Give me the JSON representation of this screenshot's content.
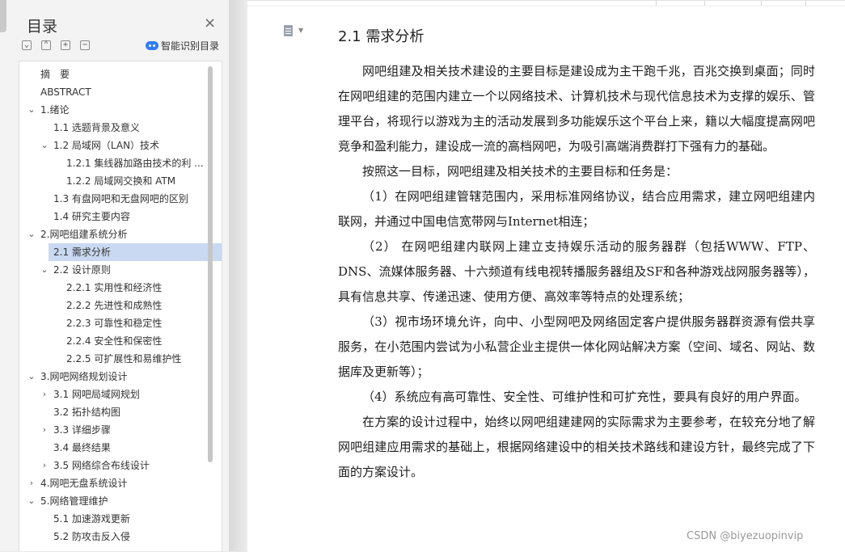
{
  "toc": {
    "title": "目录",
    "close_symbol": "×",
    "tools": [
      "⌄",
      "⌃",
      "+",
      "−"
    ],
    "smart_label": "智能识别目录",
    "items": [
      {
        "label": "摘　要",
        "level": 0,
        "arrow": "",
        "active": false
      },
      {
        "label": "ABSTRACT",
        "level": 0,
        "arrow": "",
        "active": false
      },
      {
        "label": "1.绪论",
        "level": 0,
        "arrow": "⌄",
        "active": false
      },
      {
        "label": "1.1 选题背景及意义",
        "level": 1,
        "arrow": "",
        "active": false
      },
      {
        "label": "1.2 局域网（LAN）技术",
        "level": 1,
        "arrow": "⌄",
        "active": false
      },
      {
        "label": "1.2.1 集线器加路由技术的利 ...",
        "level": 2,
        "arrow": "",
        "active": false
      },
      {
        "label": "1.2.2 局域网交换和 ATM",
        "level": 2,
        "arrow": "",
        "active": false
      },
      {
        "label": "1.3 有盘网吧和无盘网吧的区别",
        "level": 1,
        "arrow": "",
        "active": false
      },
      {
        "label": "1.4 研究主要内容",
        "level": 1,
        "arrow": "",
        "active": false
      },
      {
        "label": "2.网吧组建系统分析",
        "level": 0,
        "arrow": "⌄",
        "active": false
      },
      {
        "label": "2.1 需求分析",
        "level": 1,
        "arrow": "",
        "active": true
      },
      {
        "label": "2.2 设计原则",
        "level": 1,
        "arrow": "⌄",
        "active": false
      },
      {
        "label": "2.2.1 实用性和经济性",
        "level": 2,
        "arrow": "",
        "active": false
      },
      {
        "label": "2.2.2 先进性和成熟性",
        "level": 2,
        "arrow": "",
        "active": false
      },
      {
        "label": "2.2.3 可靠性和稳定性",
        "level": 2,
        "arrow": "",
        "active": false
      },
      {
        "label": "2.2.4 安全性和保密性",
        "level": 2,
        "arrow": "",
        "active": false
      },
      {
        "label": "2.2.5 可扩展性和易维护性",
        "level": 2,
        "arrow": "",
        "active": false
      },
      {
        "label": "3.网吧网络规划设计",
        "level": 0,
        "arrow": "⌄",
        "active": false
      },
      {
        "label": "3.1 网吧局域网规划",
        "level": 1,
        "arrow": "›",
        "active": false
      },
      {
        "label": "3.2 拓扑结构图",
        "level": 1,
        "arrow": "",
        "active": false
      },
      {
        "label": "3.3 详细步骤",
        "level": 1,
        "arrow": "›",
        "active": false
      },
      {
        "label": "3.4 最终结果",
        "level": 1,
        "arrow": "",
        "active": false
      },
      {
        "label": "3.5 网络综合布线设计",
        "level": 1,
        "arrow": "›",
        "active": false
      },
      {
        "label": "4.网吧无盘系统设计",
        "level": 0,
        "arrow": "›",
        "active": false
      },
      {
        "label": "5.网络管理维护",
        "level": 0,
        "arrow": "⌄",
        "active": false
      },
      {
        "label": "5.1 加速游戏更新",
        "level": 1,
        "arrow": "",
        "active": false
      },
      {
        "label": "5.2 防攻击反入侵",
        "level": 1,
        "arrow": "",
        "active": false
      }
    ]
  },
  "document": {
    "heading": "2.1 需求分析",
    "paragraphs": [
      "网吧组建及相关技术建设的主要目标是建设成为主干跑千兆，百兆交换到桌面；同时在网吧组建的范围内建立一个以网络技术、计算机技术与现代信息技术为支撑的娱乐、管理平台，将现行以游戏为主的活动发展到多功能娱乐这个平台上来，籍以大幅度提高网吧竞争和盈利能力，建设成一流的高档网吧，为吸引高端消费群打下强有力的基础。",
      "按照这一目标，网吧组建及相关技术的主要目标和任务是：",
      "（1）在网吧组建管辖范围内，采用标准网络协议，结合应用需求，建立网吧组建内联网，并通过中国电信宽带网与Internet相连；",
      "（2） 在网吧组建内联网上建立支持娱乐活动的服务器群（包括WWW、FTP、DNS、流媒体服务器、十六频道有线电视转播服务器组及SF和各种游戏战网服务器等），具有信息共享、传递迅速、使用方便、高效率等特点的处理系统；",
      "（3）视市场环境允许，向中、小型网吧及网络固定客户提供服务器群资源有偿共享服务，在小范围内尝试为小私营企业主提供一体化网站解决方案（空间、域名、网站、数据库及更新等）；",
      "（4）系统应有高可靠性、安全性、可维护性和可扩充性，要具有良好的用户界面。",
      "在方案的设计过程中，始终以网吧组建建网的实际需求为主要参考，在较充分地了解网吧组建应用需求的基础上，根据网络建设中的相关技术路线和建设方针，最终完成了下面的方案设计。"
    ]
  },
  "watermark": "CSDN @biyezuopinvip",
  "colors": {
    "accent": "#2f7df6",
    "active_item": "#c9d9f2",
    "panel_bg": "#f3f3f3"
  }
}
